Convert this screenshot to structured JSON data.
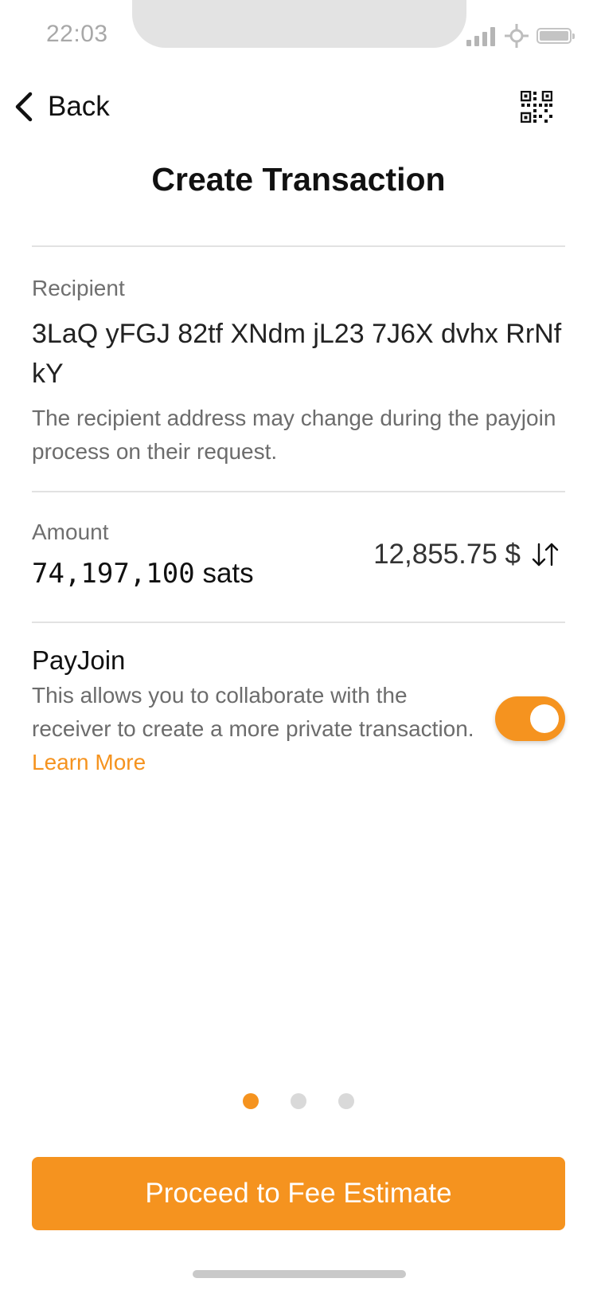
{
  "status_bar": {
    "time": "22:03"
  },
  "nav": {
    "back_label": "Back"
  },
  "page": {
    "title": "Create Transaction"
  },
  "recipient": {
    "label": "Recipient",
    "address": "3LaQ yFGJ 82tf XNdm jL23 7J6X dvhx RrNf kY",
    "note": "The recipient address may change during the payjoin process on their request."
  },
  "amount": {
    "label": "Amount",
    "sats_value": "74,197,100",
    "sats_unit": "sats",
    "fiat_value": "12,855.75 $"
  },
  "payjoin": {
    "title": "PayJoin",
    "description": "This allows you to collaborate with the receiver to create a more private transaction.",
    "learn_more": "Learn More",
    "enabled": true
  },
  "pager": {
    "total": 3,
    "active_index": 0
  },
  "cta": {
    "label": "Proceed to Fee Estimate"
  },
  "colors": {
    "accent": "#f5931f",
    "divider": "#e2e2e2",
    "muted_text": "#6c6c6c"
  }
}
